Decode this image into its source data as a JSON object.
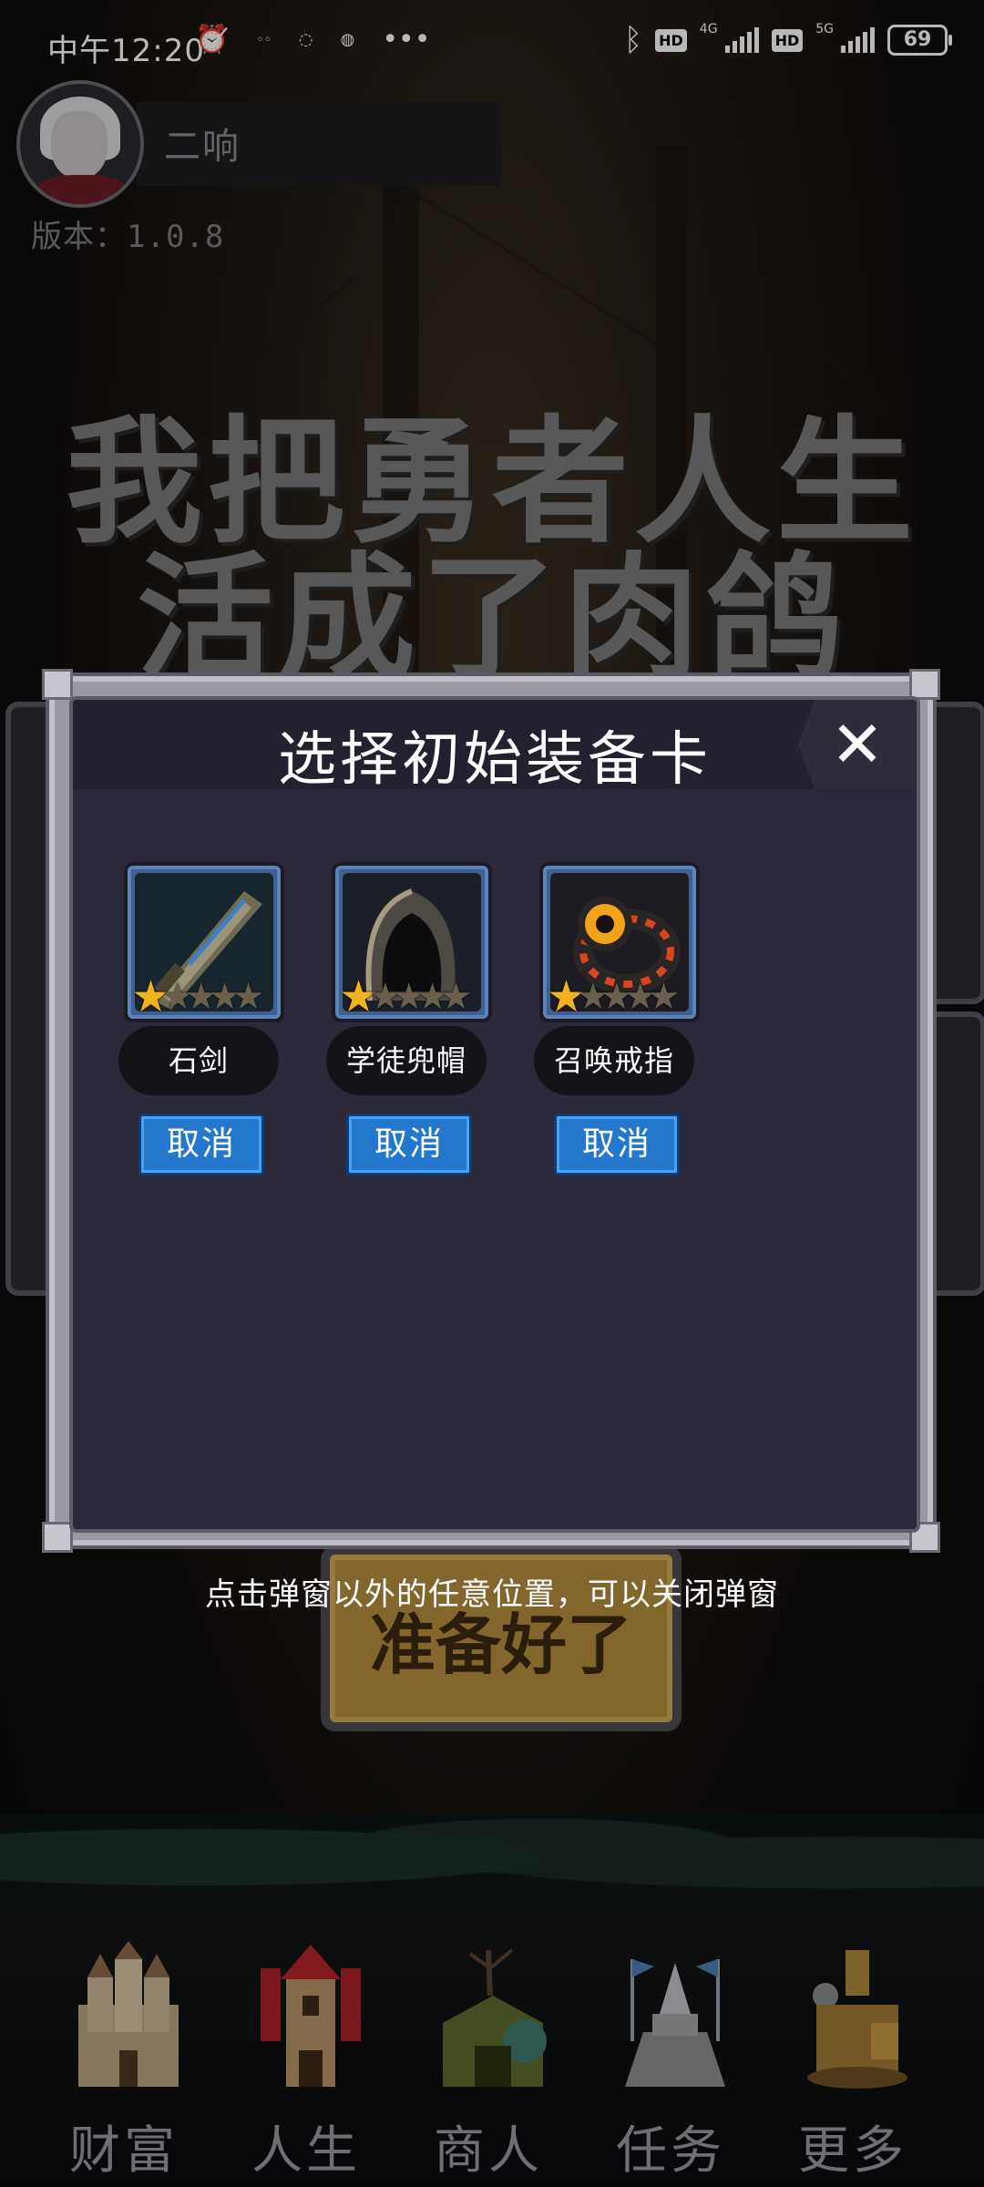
{
  "status_bar": {
    "time": "中午12:20",
    "network_4g": "4G",
    "network_5g": "5G",
    "hd_1": "HD",
    "hd_2": "HD",
    "battery": "69"
  },
  "user": {
    "name": "二响",
    "version": "版本：1.0.8"
  },
  "game": {
    "title_line1": "我把勇者人生",
    "title_line2": "活成了肉鸽",
    "ready_label": "准备好了"
  },
  "modal": {
    "title": "选择初始装备卡",
    "close_symbol": "✕",
    "items": [
      {
        "name": "石剑",
        "stars": 1,
        "max_stars": 5,
        "cancel_label": "取消"
      },
      {
        "name": "学徒兜帽",
        "stars": 1,
        "max_stars": 5,
        "cancel_label": "取消"
      },
      {
        "name": "召唤戒指",
        "stars": 1,
        "max_stars": 5,
        "cancel_label": "取消"
      }
    ]
  },
  "hint": "点击弹窗以外的任意位置，可以关闭弹窗",
  "nav": [
    {
      "label": "财富",
      "icon": "castle-icon"
    },
    {
      "label": "人生",
      "icon": "tower-icon"
    },
    {
      "label": "商人",
      "icon": "merchant-tent-icon"
    },
    {
      "label": "任务",
      "icon": "quest-altar-icon"
    },
    {
      "label": "更多",
      "icon": "workshop-icon"
    }
  ],
  "colors": {
    "modal_bg": "#2b2839",
    "cancel_button": "#2377cc",
    "star_on": "#f2b21d"
  }
}
